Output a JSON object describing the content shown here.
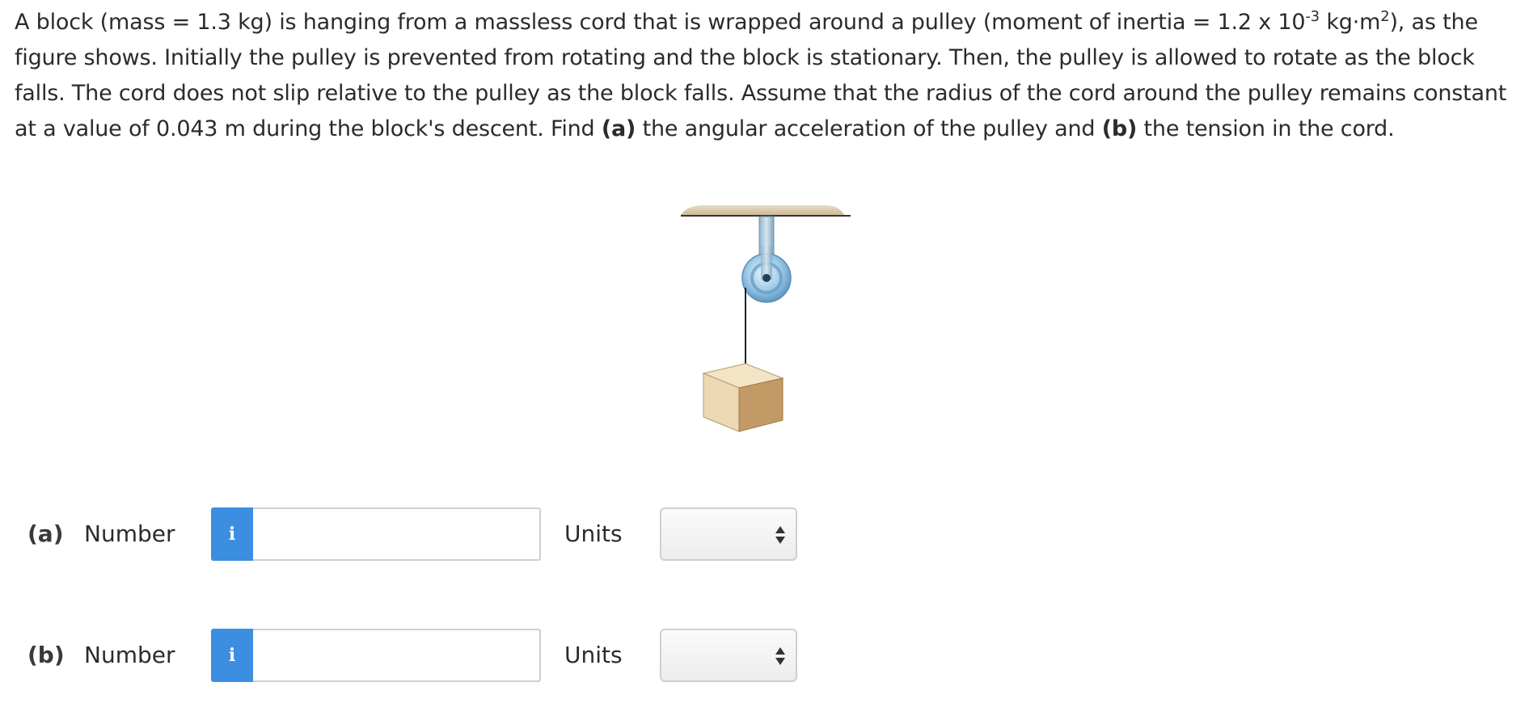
{
  "question": {
    "part1": "A block (mass = 1.3 kg) is hanging from a massless cord that is wrapped around a pulley (moment of inertia = 1.2 x 10",
    "exp1": "-3",
    "part2": " kg·m",
    "exp2": "2",
    "part3": "), as the figure shows. Initially the pulley is prevented from rotating and the block is stationary. Then, the pulley is allowed to rotate as the block falls. The cord does not slip relative to the pulley as the block falls. Assume that the radius of the cord around the pulley remains constant at a value of 0.043 m during the block's descent. Find ",
    "bold_a": "(a)",
    "part4": " the angular acceleration of the pulley and ",
    "bold_b": "(b)",
    "part5": " the tension in the cord."
  },
  "answers": [
    {
      "part_label": "(a)",
      "number_label": "Number",
      "info_glyph": "i",
      "value": "",
      "units_label": "Units",
      "units_selected": ""
    },
    {
      "part_label": "(b)",
      "number_label": "Number",
      "info_glyph": "i",
      "value": "",
      "units_label": "Units",
      "units_selected": ""
    }
  ],
  "colors": {
    "info_button": "#3b8ee0",
    "ceiling": "#d8c9ad",
    "pulley": "#7fb9dc",
    "block_front": "#ecd9b4",
    "block_side": "#c19a66"
  }
}
